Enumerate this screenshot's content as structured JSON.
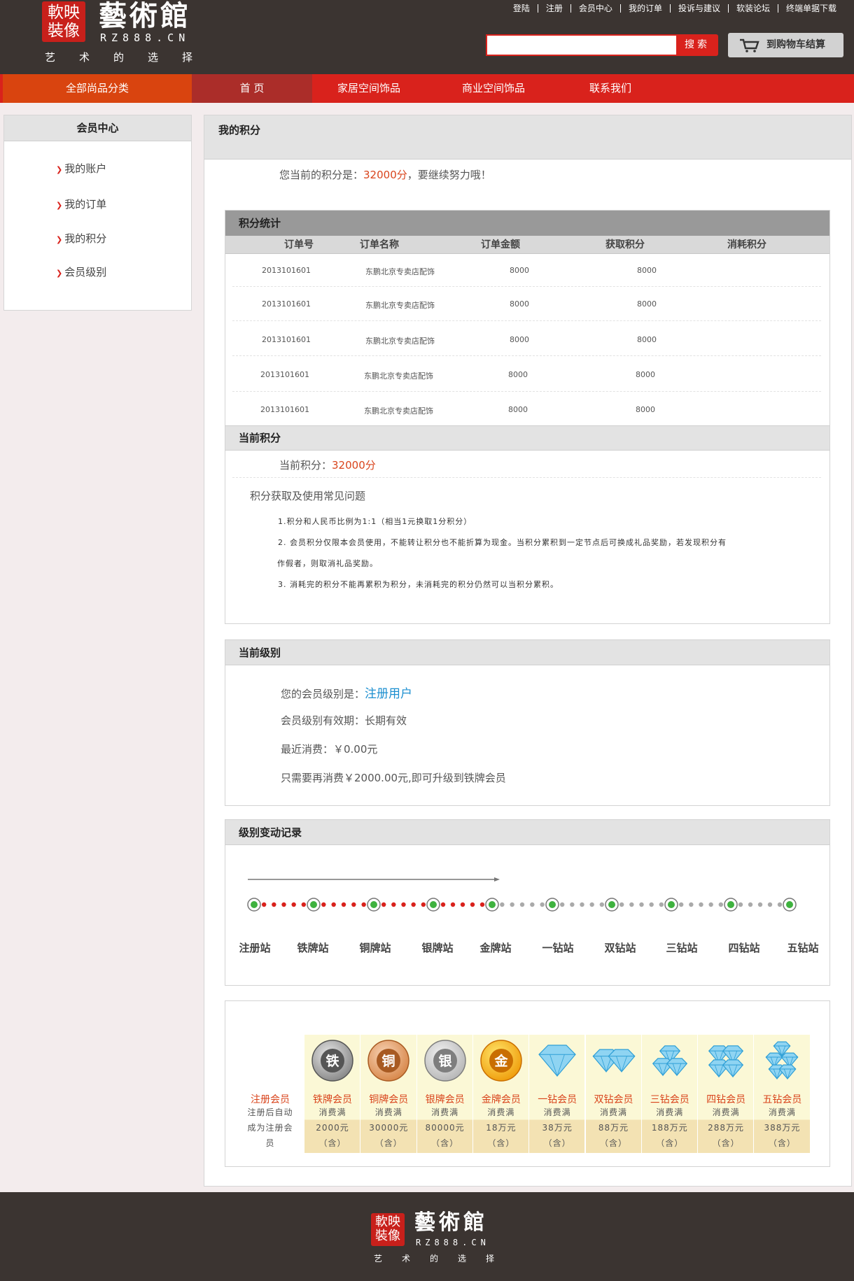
{
  "header": {
    "logo_seal": "軟映\n裝像",
    "logo_name": "藝術館",
    "logo_url": "RZ888.CN",
    "logo_slogan": "艺术的选择",
    "top_links": [
      "登陆",
      "注册",
      "会员中心",
      "我的订单",
      "投诉与建议",
      "软装论坛",
      "终端单据下载"
    ],
    "search_placeholder": "",
    "search_button": "搜索",
    "cart_button": "到购物车结算"
  },
  "nav": {
    "items": [
      "全部尚品分类",
      "首 页",
      "家居空间饰品",
      "商业空间饰品",
      "联系我们"
    ],
    "colors": {
      "category": "#d9440f",
      "active": "#ab2d29",
      "bar": "#d9221c"
    }
  },
  "sidebar": {
    "title": "会员中心",
    "items": [
      "我的账户",
      "我的订单",
      "我的积分",
      "会员级别"
    ]
  },
  "main": {
    "title": "我的积分",
    "points_prefix": "您当前的积分是：",
    "points_value": "32000分",
    "points_suffix": "，要继续努力哦！"
  },
  "stats": {
    "title": "积分统计",
    "columns": [
      "订单号",
      "订单名称",
      "订单金额",
      "获取积分",
      "消耗积分"
    ],
    "rows": [
      [
        "2013101601",
        "东鹏北京专卖店配饰",
        "8000",
        "8000",
        ""
      ],
      [
        "2013101601",
        "东鹏北京专卖店配饰",
        "8000",
        "8000",
        ""
      ],
      [
        "2013101601",
        "东鹏北京专卖店配饰",
        "8000",
        "8000",
        ""
      ],
      [
        "2013101601",
        "东鹏北京专卖店配饰",
        "8000",
        "8000",
        ""
      ],
      [
        "2013101601",
        "东鹏北京专卖店配饰",
        "8000",
        "8000",
        ""
      ]
    ]
  },
  "current_points": {
    "title": "当前积分",
    "label": "当前积分：",
    "value": "32000分",
    "faq_title": "积分获取及使用常见问题",
    "faq": [
      "1.积分和人民币比例为1:1（相当1元换取1分积分）",
      "2. 会员积分仅限本会员使用，不能转让积分也不能折算为现金。当积分累积到一定节点后可换成礼品奖励，若发现积分有",
      "作假者，则取消礼品奖励。",
      "3. 消耗完的积分不能再累积为积分，未消耗完的积分仍然可以当积分累积。"
    ]
  },
  "level": {
    "title": "当前级别",
    "level_label": "您的会员级别是：",
    "level_value": "注册用户",
    "validity": "会员级别有效期：长期有效",
    "recent": "最近消费：￥0.00元",
    "upgrade": "只需要再消费￥2000.00元,即可升级到铁牌会员"
  },
  "history": {
    "title": "级别变动记录",
    "stations": [
      "注册站",
      "铁牌站",
      "铜牌站",
      "银牌站",
      "金牌站",
      "一钻站",
      "双钻站",
      "三钻站",
      "四钻站",
      "五钻站"
    ],
    "reached_segments": 4
  },
  "tiers": {
    "base_name": "注册会员",
    "base_desc": [
      "注册后自动",
      "成为注册会",
      "员"
    ],
    "items": [
      {
        "name": "铁牌会员",
        "icon": "iron-medal-icon",
        "glyph": "铁",
        "req": [
          "消费满",
          "2000元",
          "（含）"
        ]
      },
      {
        "name": "铜牌会员",
        "icon": "copper-medal-icon",
        "glyph": "铜",
        "req": [
          "消费满",
          "30000元",
          "（含）"
        ]
      },
      {
        "name": "银牌会员",
        "icon": "silver-medal-icon",
        "glyph": "银",
        "req": [
          "消费满",
          "80000元",
          "（含）"
        ]
      },
      {
        "name": "金牌会员",
        "icon": "gold-medal-icon",
        "glyph": "金",
        "req": [
          "消费满",
          "18万元",
          "（含）"
        ]
      },
      {
        "name": "一钻会员",
        "icon": "one-diamond-icon",
        "glyph": "",
        "req": [
          "消费满",
          "38万元",
          "（含）"
        ]
      },
      {
        "name": "双钻会员",
        "icon": "two-diamond-icon",
        "glyph": "",
        "req": [
          "消费满",
          "88万元",
          "（含）"
        ]
      },
      {
        "name": "三钻会员",
        "icon": "three-diamond-icon",
        "glyph": "",
        "req": [
          "消费满",
          "188万元",
          "（含）"
        ]
      },
      {
        "name": "四钻会员",
        "icon": "four-diamond-icon",
        "glyph": "",
        "req": [
          "消费满",
          "288万元",
          "（含）"
        ]
      },
      {
        "name": "五钻会员",
        "icon": "five-diamond-icon",
        "glyph": "",
        "req": [
          "消费满",
          "388万元",
          "（含）"
        ]
      }
    ]
  },
  "footer": {
    "logo_seal": "軟映\n裝像",
    "logo_name": "藝術館",
    "logo_url": "RZ888.CN",
    "logo_slogan": "艺术的选择"
  }
}
